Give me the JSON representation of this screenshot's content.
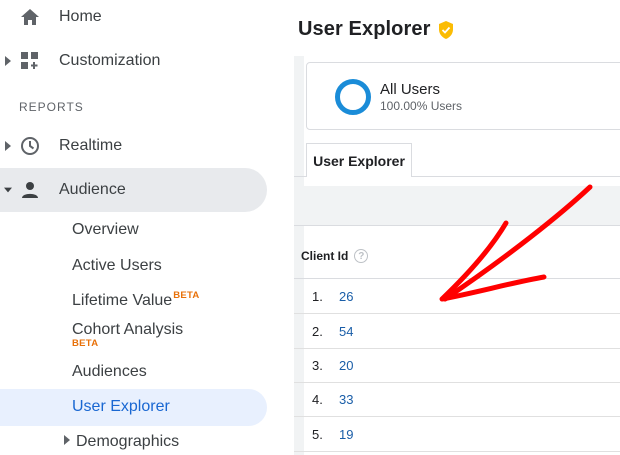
{
  "sidebar": {
    "home_label": "Home",
    "customization_label": "Customization",
    "reports_heading": "REPORTS",
    "realtime_label": "Realtime",
    "audience_label": "Audience",
    "audience_items": {
      "overview": "Overview",
      "active_users": "Active Users",
      "lifetime_value": "Lifetime Value",
      "lifetime_value_badge": "BETA",
      "cohort_analysis": "Cohort Analysis",
      "cohort_analysis_badge": "BETA",
      "audiences": "Audiences",
      "user_explorer": "User Explorer",
      "demographics": "Demographics"
    }
  },
  "main": {
    "title": "User Explorer",
    "segment": {
      "name": "All Users",
      "percent": "100.00% Users"
    },
    "tab_label": "User Explorer",
    "table": {
      "column_header": "Client Id",
      "help_glyph": "?",
      "rows": [
        {
          "index": "1.",
          "client_id": "26"
        },
        {
          "index": "2.",
          "client_id": "54"
        },
        {
          "index": "3.",
          "client_id": "20"
        },
        {
          "index": "4.",
          "client_id": "33"
        },
        {
          "index": "5.",
          "client_id": "19"
        }
      ]
    }
  },
  "colors": {
    "accent_blue": "#1967d2",
    "active_bg": "#e8f0fe",
    "beta_orange": "#e8710a",
    "annotation_red": "#ff0000",
    "verified_yellow": "#fbbc04",
    "ring_blue": "#1a8cd8"
  },
  "icons": {
    "home": "home-icon",
    "customization": "dashboard-customize-icon",
    "realtime": "clock-icon",
    "audience": "person-icon",
    "verified": "verified-badge-icon"
  }
}
